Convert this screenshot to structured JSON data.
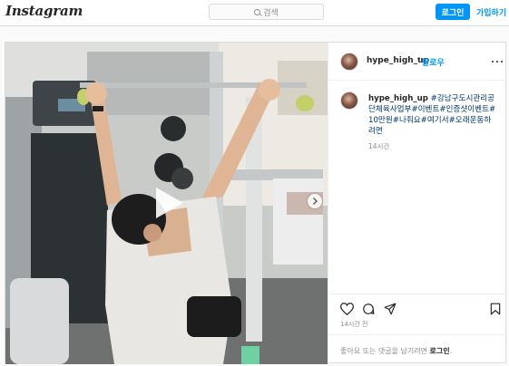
{
  "nav": {
    "logo": "Instagram",
    "search_placeholder": "검색",
    "login_label": "로그인",
    "signup_label": "가입하기"
  },
  "post": {
    "username": "hype_high_up",
    "separator": "•",
    "follow_label": "팔로우",
    "caption_text": "#강남구도시관리공단체육사업부#이벤트#인증샷이벤트#10만원#나줘요#여기서#오래운동하려면",
    "caption_time": "14시간",
    "timestamp": "14시간 전",
    "footer_prompt": "좋아요 또는 댓글을 남기려면",
    "footer_login": "로그인",
    "footer_period": "."
  },
  "icons": {
    "like": "heart-icon",
    "comment": "comment-icon",
    "share": "share-icon",
    "save": "bookmark-icon",
    "more": "more-options-icon",
    "carousel": "chevron-right-icon",
    "play": "play-icon"
  },
  "colors": {
    "accent": "#0095f6",
    "hashtag": "#00376b",
    "muted": "#8e8e8e",
    "border": "#dbdbdb"
  }
}
